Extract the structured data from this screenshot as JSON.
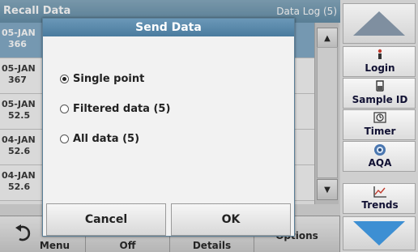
{
  "header": {
    "title": "Recall Data",
    "right": "Data Log (5)"
  },
  "list": [
    {
      "date": "05-JAN",
      "value": "366",
      "selected": true
    },
    {
      "date": "05-JAN",
      "value": "367",
      "selected": false
    },
    {
      "date": "05-JAN",
      "value": "52.5",
      "selected": false
    },
    {
      "date": "04-JAN",
      "value": "52.6",
      "selected": false
    },
    {
      "date": "04-JAN",
      "value": "52.6",
      "selected": false
    }
  ],
  "sidebar": {
    "login": {
      "label": "Login",
      "icon": "person-icon"
    },
    "sample_id": {
      "label": "Sample ID",
      "icon": "flask-icon"
    },
    "timer": {
      "label": "Timer",
      "icon": "timer-icon"
    },
    "aqa": {
      "label": "AQA",
      "icon": "aqa-icon"
    },
    "trends": {
      "label": "Trends",
      "icon": "trends-icon"
    }
  },
  "bottom": {
    "menu": "Menu",
    "off": "Off",
    "details": "Details",
    "options": "Options"
  },
  "dialog": {
    "title": "Send Data",
    "options": [
      {
        "label": "Single point",
        "selected": true
      },
      {
        "label": "Filtered data (5)",
        "selected": false
      },
      {
        "label": "All data (5)",
        "selected": false
      }
    ],
    "cancel": "Cancel",
    "ok": "OK"
  },
  "colors": {
    "accent": "#5f8aa5",
    "nav_down": "#3d8fd3"
  }
}
